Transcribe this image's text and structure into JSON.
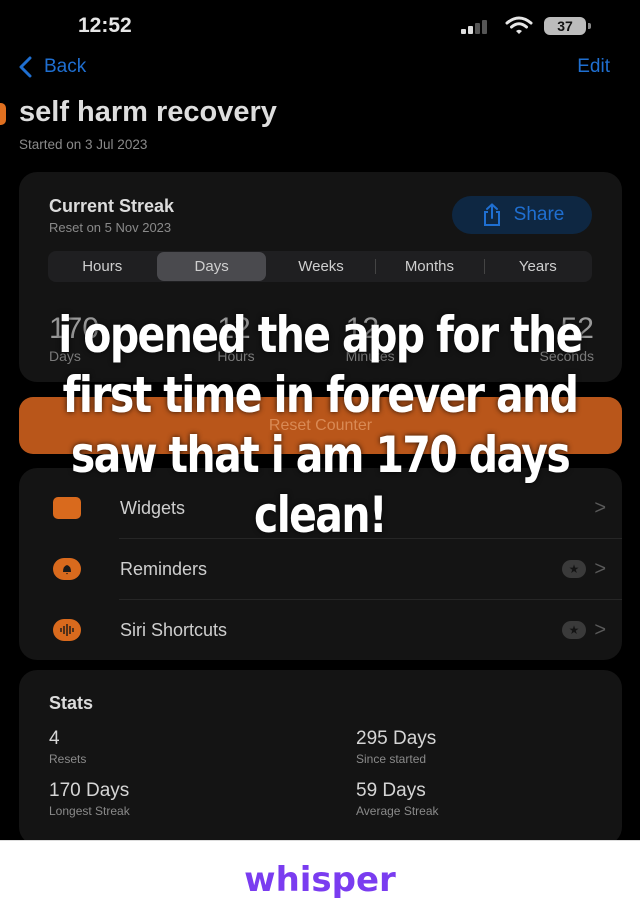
{
  "status_bar": {
    "time": "12:52",
    "battery": "37"
  },
  "nav": {
    "back_label": "Back",
    "edit_label": "Edit"
  },
  "header": {
    "title": "self harm recovery",
    "subtitle": "Started on 3 Jul 2023",
    "accent_color": "#e07020"
  },
  "streak": {
    "title": "Current Streak",
    "subtitle": "Reset on 5 Nov 2023",
    "share_label": "Share",
    "units": [
      {
        "label": "Hours",
        "active": false
      },
      {
        "label": "Days",
        "active": true
      },
      {
        "label": "Weeks",
        "active": false
      },
      {
        "label": "Months",
        "active": false
      },
      {
        "label": "Years",
        "active": false
      }
    ],
    "counter": [
      {
        "value": "170",
        "label": "Days"
      },
      {
        "value": "12",
        "label": "Hours"
      },
      {
        "value": "12",
        "label": "Minutes"
      },
      {
        "value": "52",
        "label": "Seconds"
      }
    ]
  },
  "reset_button": {
    "label": "Reset Counter"
  },
  "menu": [
    {
      "label": "Widgets",
      "icon": "widgets-icon",
      "premium": false
    },
    {
      "label": "Reminders",
      "icon": "bell-icon",
      "premium": true
    },
    {
      "label": "Siri Shortcuts",
      "icon": "waveform-icon",
      "premium": true
    }
  ],
  "stats": {
    "title": "Stats",
    "items": [
      {
        "value": "4",
        "label": "Resets"
      },
      {
        "value": "295 Days",
        "label": "Since started"
      },
      {
        "value": "170 Days",
        "label": "Longest Streak"
      },
      {
        "value": "59 Days",
        "label": "Average Streak"
      }
    ]
  },
  "overlay": {
    "text": "i opened the app for the first time in forever and saw that i am 170 days clean!"
  },
  "footer": {
    "brand": "whisper",
    "brand_color": "#7a3cf0"
  }
}
